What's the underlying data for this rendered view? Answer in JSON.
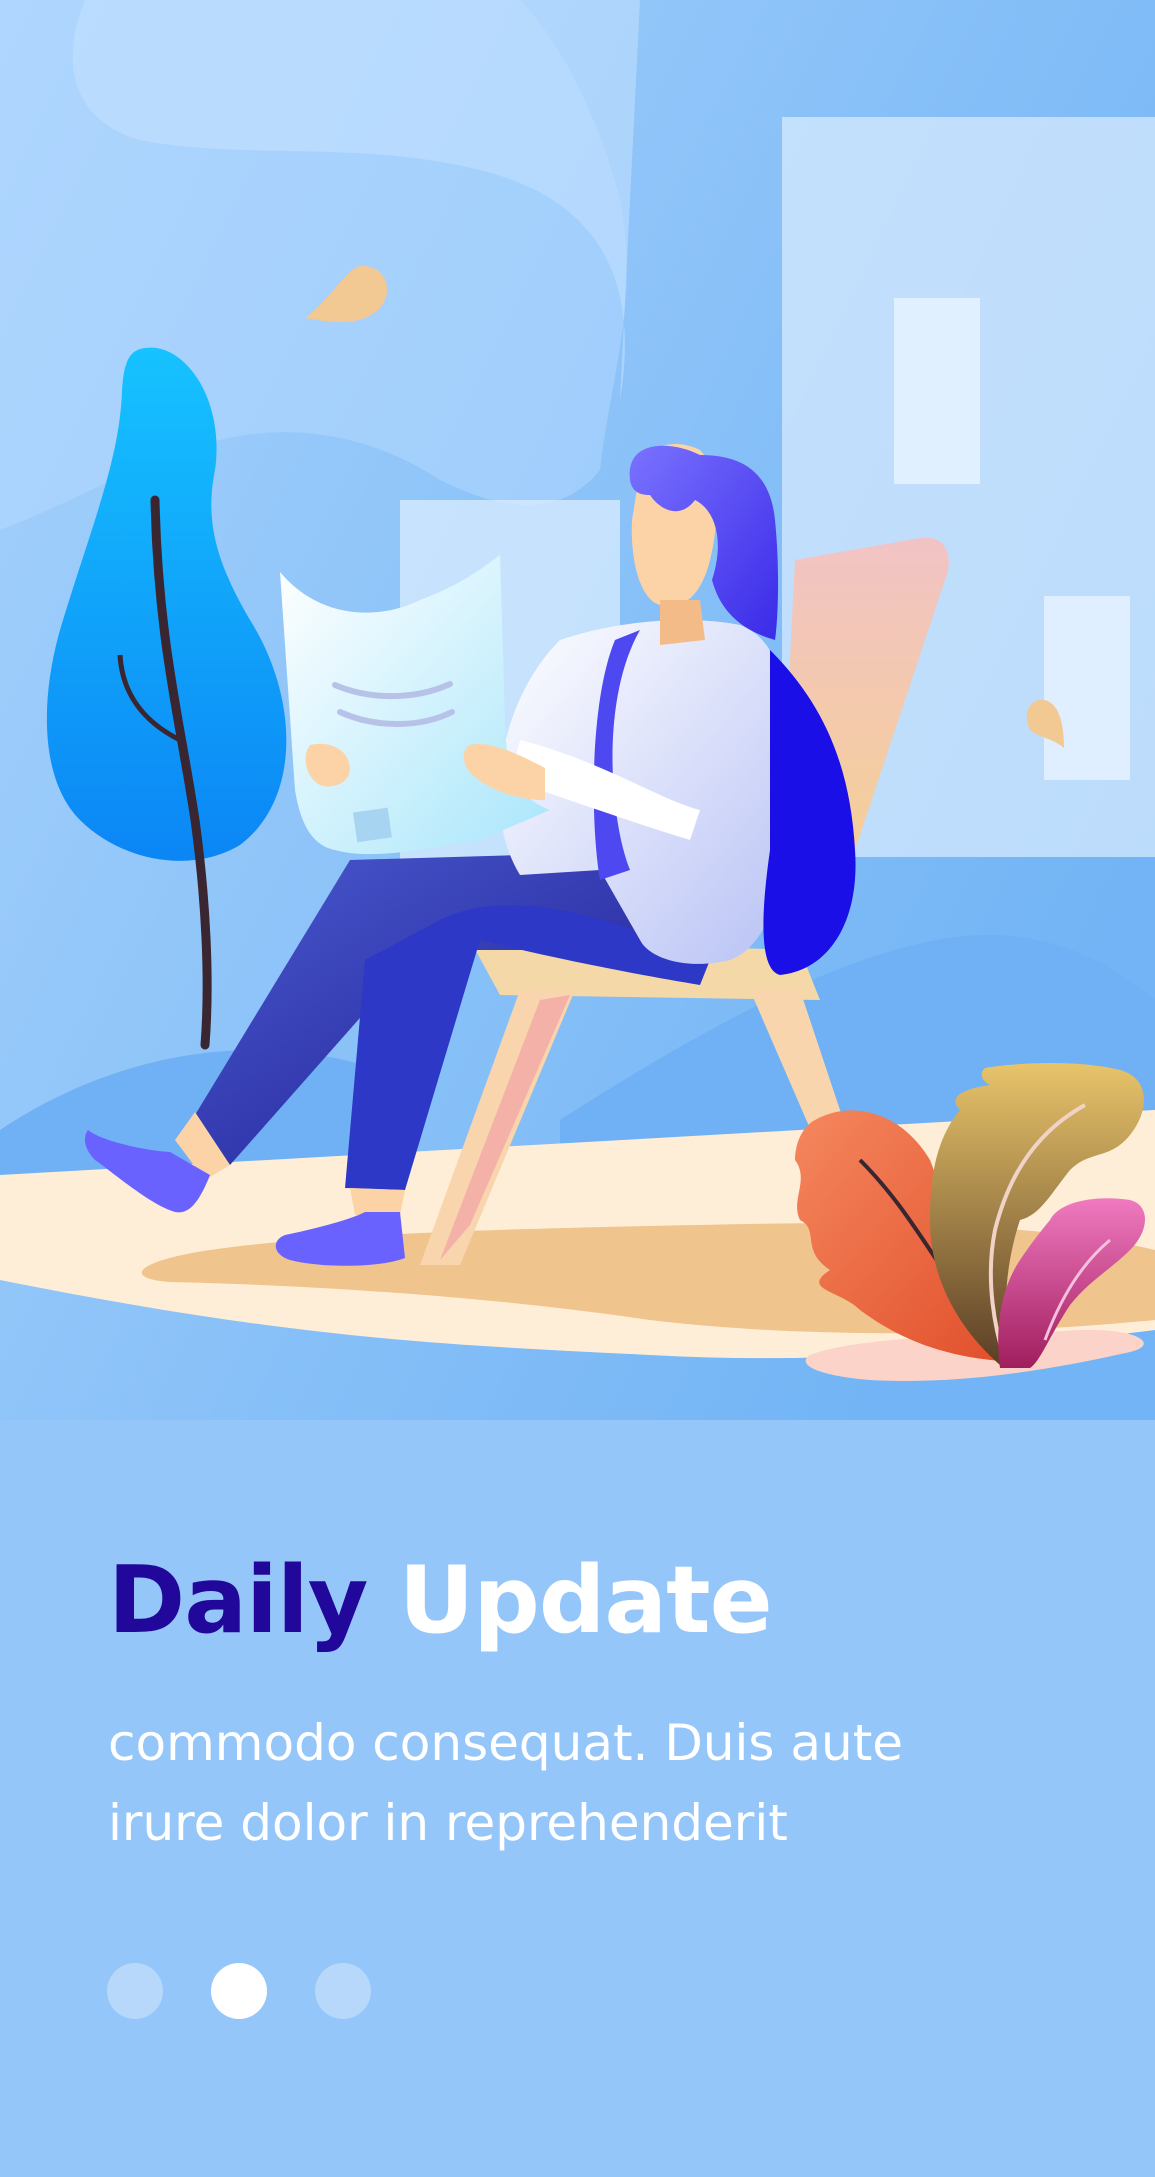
{
  "onboarding": {
    "title_accent": "Daily",
    "title_main": "Update",
    "description_lines": [
      "commodo consequat. Duis aute",
      "irure dolor in reprehenderit"
    ]
  },
  "pagination": {
    "total_pages": 3,
    "active_page": 2
  },
  "colors": {
    "background": "#95c6fa",
    "title_accent": "#22089a",
    "text": "#ffffff",
    "dot_active": "#ffffff",
    "dot_inactive": "rgba(255,255,255,0.32)"
  },
  "illustration": {
    "subject": "woman-reading-newspaper-on-chair-icon",
    "elements": [
      "tree-icon",
      "chair-icon",
      "plant-icon",
      "building-icon",
      "leaf-icon"
    ]
  }
}
